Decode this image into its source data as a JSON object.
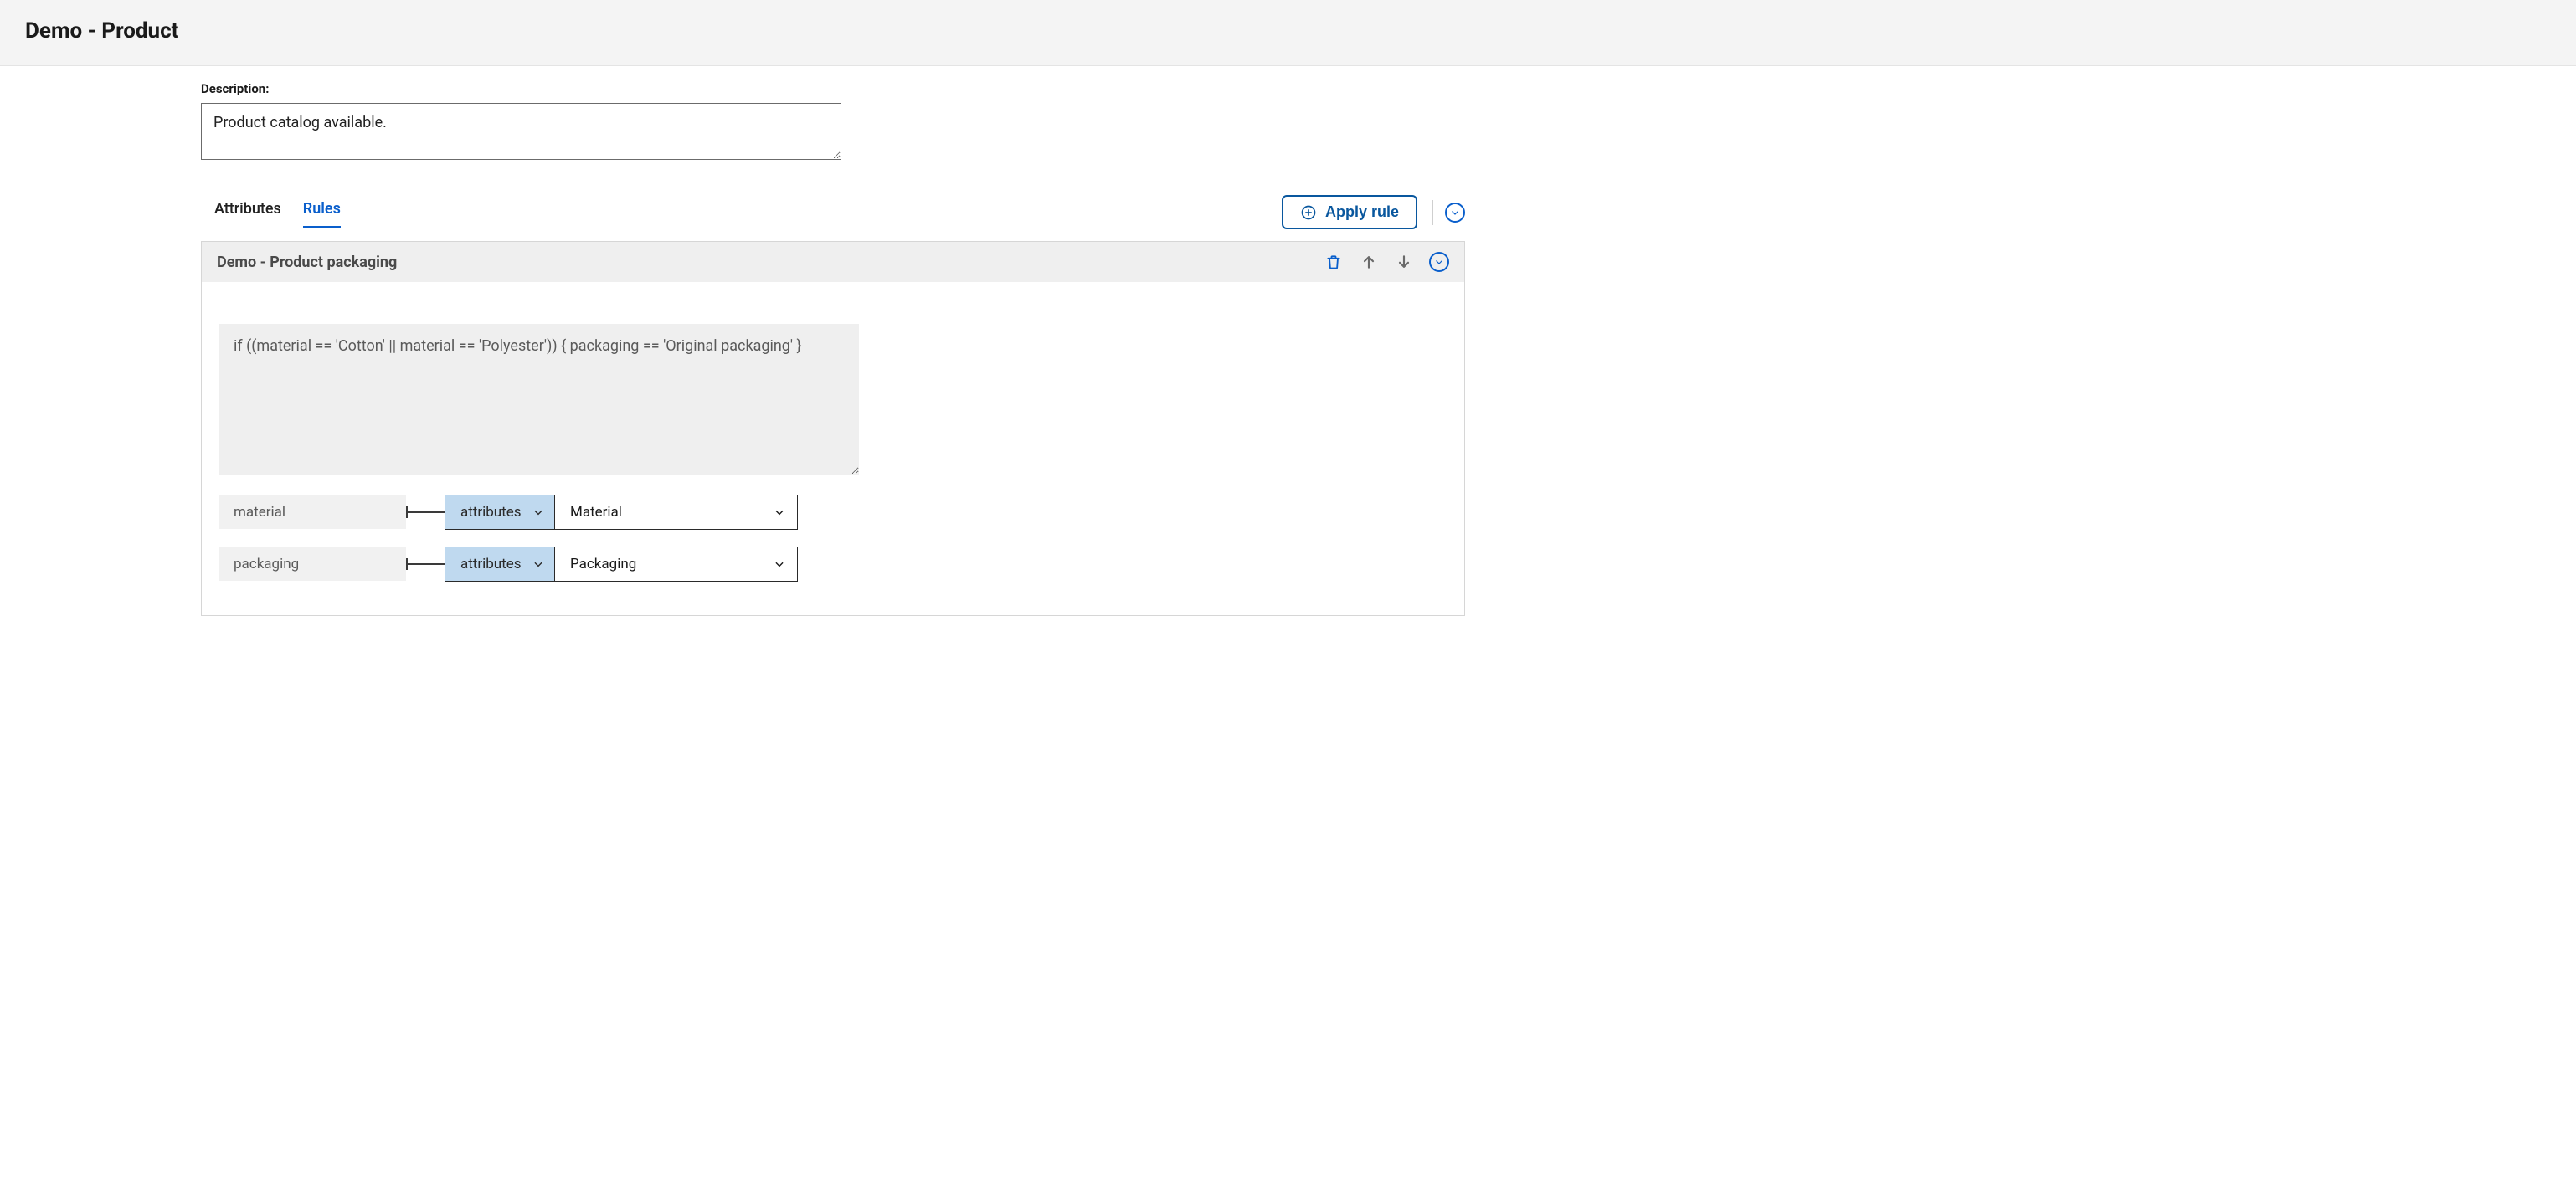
{
  "header": {
    "title": "Demo - Product"
  },
  "description": {
    "label": "Description:",
    "value": "Product catalog available."
  },
  "tabs": {
    "attributes": "Attributes",
    "rules": "Rules"
  },
  "apply_rule_label": "Apply rule",
  "rule": {
    "title": "Demo - Product packaging",
    "code": "if ((material == 'Cotton' || material == 'Polyester')) { packaging == 'Original packaging' }",
    "bindings": [
      {
        "var": "material",
        "type": "attributes",
        "value": "Material"
      },
      {
        "var": "packaging",
        "type": "attributes",
        "value": "Packaging"
      }
    ]
  }
}
